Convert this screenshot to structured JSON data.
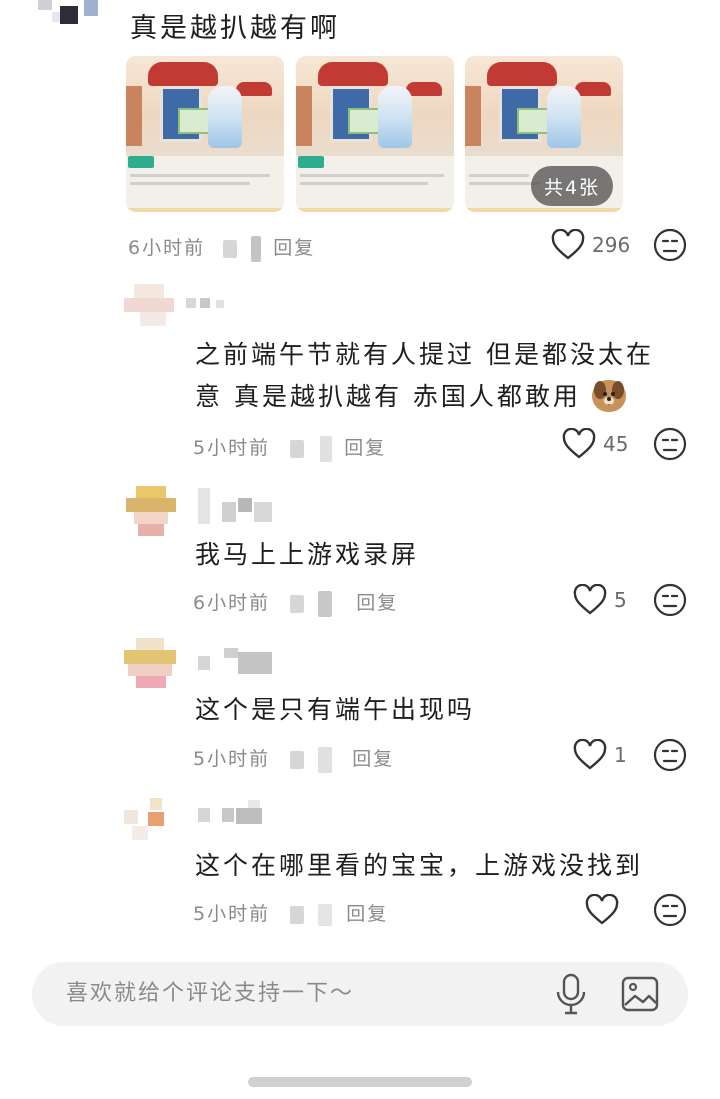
{
  "top_comment": {
    "text": "真是越扒越有啊",
    "images": [
      {
        "tag": "玩物志",
        "caption": "简述么点事，都能吵出天大的气势，要里由送份认真用心的防护，许多事大概会容易得多。"
      },
      {
        "tag": "玩物志",
        "caption": "国人会在端午时包粽子，供屈原避邪驱瘟，传得久，花样越来越多，到最后这口味也要争个高低。"
      },
      {
        "tag": "",
        "caption": "午前天，有些赤国人赤脚上山，到处都是热闹的景象。"
      }
    ],
    "more_images_label": "共4张",
    "time": "6小时前",
    "reply_label": "回复",
    "like_count": "296"
  },
  "replies": [
    {
      "text_line1": "之前端午节就有人提过 但是都没太在",
      "text_line2": "意 真是越扒越有 赤国人都敢用",
      "emoji": "dog-emoji",
      "time": "5小时前",
      "reply_label": "回复",
      "like_count": "45"
    },
    {
      "text_line1": "我马上上游戏录屏",
      "time": "6小时前",
      "reply_label": "回复",
      "like_count": "5"
    },
    {
      "text_line1": "这个是只有端午出现吗",
      "time": "5小时前",
      "reply_label": "回复",
      "like_count": "1"
    },
    {
      "text_line1": "这个在哪里看的宝宝，上游戏没找到",
      "time": "5小时前",
      "reply_label": "回复",
      "like_count": ""
    }
  ],
  "input": {
    "placeholder": "喜欢就给个评论支持一下～"
  },
  "icons": {
    "like": "heart-icon",
    "dislike": "dislike-face-icon",
    "mic": "microphone-icon",
    "image": "image-picker-icon"
  },
  "colors": {
    "text": "#1e1e1e",
    "meta": "#8a8a8a",
    "input_bg": "#f2f2f2",
    "badge_bg": "#464646"
  }
}
